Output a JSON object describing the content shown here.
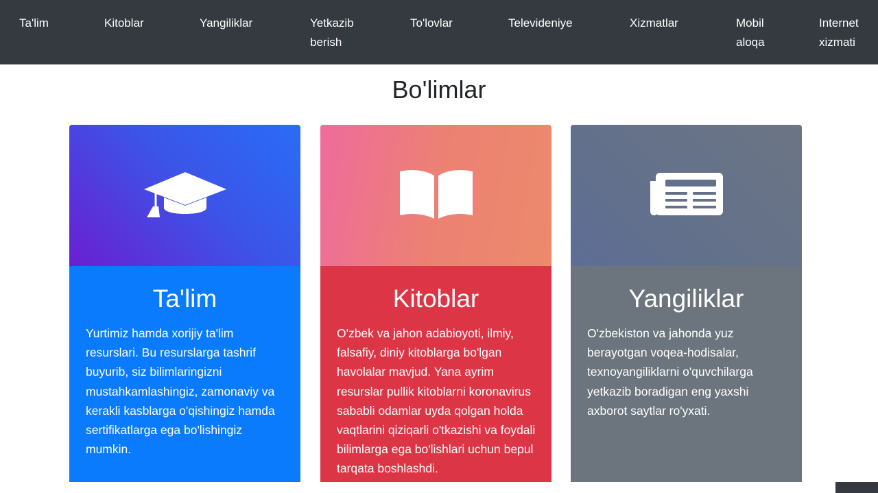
{
  "nav": {
    "items": [
      {
        "lines": [
          "Ta'lim"
        ]
      },
      {
        "lines": [
          "Kitoblar"
        ]
      },
      {
        "lines": [
          "Yangiliklar"
        ]
      },
      {
        "lines": [
          "Yetkazib",
          "berish"
        ]
      },
      {
        "lines": [
          "To'lovlar"
        ]
      },
      {
        "lines": [
          "Televideniye"
        ]
      },
      {
        "lines": [
          "Xizmatlar"
        ]
      },
      {
        "lines": [
          "Mobil",
          "aloqa"
        ]
      },
      {
        "lines": [
          "Internet",
          "xizmati"
        ]
      }
    ]
  },
  "page": {
    "title": "Bo'limlar"
  },
  "cards": [
    {
      "icon": "graduation-cap-icon",
      "title": "Ta'lim",
      "text": "Yurtimiz hamda xorijiy ta'lim resurslari. Bu resurslarga tashrif buyurib, siz bilimlaringizni mustahkamlashingiz, zamonaviy va kerakli kasblarga o'qishingiz hamda sertifikatlarga ega bo'lishingiz mumkin."
    },
    {
      "icon": "open-book-icon",
      "title": "Kitoblar",
      "text": "O'zbek va jahon adabioyoti, ilmiy, falsafiy, diniy kitoblarga bo'lgan havolalar mavjud. Yana ayrim resurslar pullik kitoblarni koronavirus sababli odamlar uyda qolgan holda vaqtlarini qiziqarli o'tkazishi va foydali bilimlarga ega bo'lishlari uchun bepul tarqata boshlashdi."
    },
    {
      "icon": "newspaper-icon",
      "title": "Yangiliklar",
      "text": "O'zbekiston va jahonda yuz berayotgan voqea-hodisalar, texnoyangiliklarni o'quvchilarga yetkazib boradigan eng yaxshi axborot saytlar ro'yxati."
    }
  ],
  "colors": {
    "navbar": "#343a40",
    "card_talim": "#0a7bfc",
    "card_kitoblar": "#dc3545",
    "card_yangiliklar": "#6c757d"
  }
}
